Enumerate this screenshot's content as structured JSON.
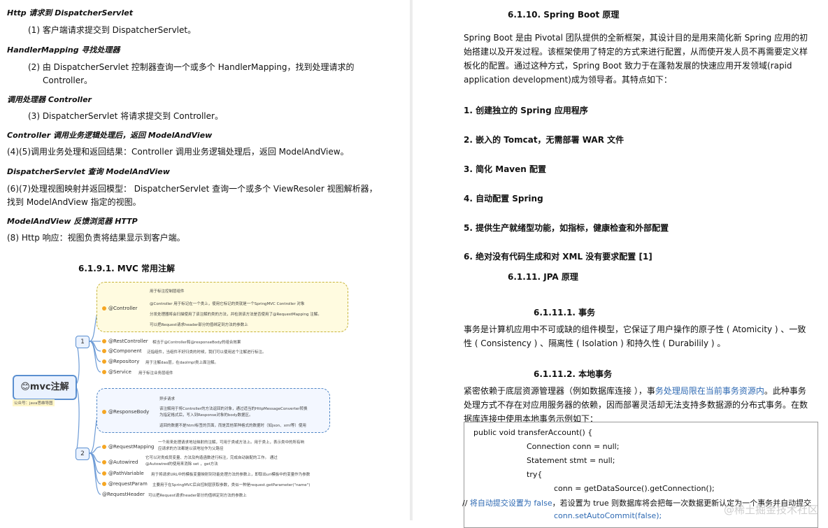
{
  "left": {
    "blocks": [
      {
        "heading": "Http 请求到 DispatcherServlet",
        "lines": [
          "(1) 客户端请求提交到 DispatcherServlet。"
        ]
      },
      {
        "heading": "HandlerMapping 寻找处理器",
        "lines": [
          "(2) 由 DispatcherServlet 控制器查询一个或多个 HandlerMapping，找到处理请求的",
          "Controller。"
        ]
      },
      {
        "heading": "调用处理器 Controller",
        "lines": [
          "(3) DispatcherServlet 将请求提交到 Controller。"
        ]
      },
      {
        "heading": "Controller 调用业务逻辑处理后，返回 ModelAndView",
        "lines": [
          "(4)(5)调用业务处理和返回结果：Controller 调用业务逻辑处理后，返回 ModelAndView。"
        ]
      },
      {
        "heading": "DispatcherServlet 查询 ModelAndView",
        "lines": [
          "(6)(7)处理视图映射并返回模型： DispatcherServlet 查询一个或多个 ViewResoler 视图解析器，",
          "找到 ModelAndView 指定的视图。"
        ]
      },
      {
        "heading": "ModelAndView 反馈浏览器 HTTP",
        "lines": [
          "(8) Http 响应：视图负责将结果显示到客户端。"
        ]
      }
    ],
    "section_title": "6.1.9.1.    MVC 常用注解",
    "mindmap": {
      "root": "😊mvc注解",
      "root_note": "公众号：java思维导图",
      "group1": "1",
      "group2": "2",
      "controller": {
        "label": "@Controller",
        "notes": [
          "用于标注控制层组件",
          "@Controller 用于标记在一个类上，使用它标记的类就是一个SpringMVC Controller 对象",
          "分发处理器将会扫描使用了该注解的类的方法，并检测该方法是否使用了@RequestMapping 注解。",
          "可以把Request请求header部分的值绑定到方法的参数上"
        ]
      },
      "items1": [
        {
          "label": "@RestController",
          "note": "相当于@Controller和@responseBody的组合效果"
        },
        {
          "label": "@Component",
          "note": "泛指组件，当组件不好归类的时候，我们可以使用这个注解进行标注。"
        },
        {
          "label": "@Repository",
          "note": "用于注解dao层，在daoImpl类上面注解。"
        },
        {
          "label": "@Service",
          "note": "用于标注业务层组件"
        }
      ],
      "responsebody": {
        "label": "@ResponseBody",
        "notes": [
          "异步请求",
          "该注解用于将Controller的方法返回的对象，通过适当的HttpMessageConverter转换",
          "为指定格式后，写入到Response对象的body数据区。",
          "返回的数据不是html标签的页面，而是其他某种格式的数据时（如json、xml等）使用"
        ]
      },
      "items2": [
        {
          "label": "@RequestMapping",
          "note": "一个用来处理请求地址映射的注解，可用于类或方法上。用于类上，表示类中的所有响",
          "note2": "应请求的方法都是以该地址作为父路径"
        },
        {
          "label": "@Autowired",
          "note": "它可以对类成员变量、方法及构造函数进行标注，完成自动装配的工作。 通过",
          "note2": "@Autowired的使用来消除 set ，get方法"
        },
        {
          "label": "@PathVariable",
          "note": "用于将请求URL中的模板变量映射到功能处理方法的参数上，即取出uri模板中的变量作为参数",
          "note2": ""
        },
        {
          "label": "@requestParam",
          "note": "主要用于在SpringMVC后台控制层获取参数，类似一种是request.getParameter(\"name\")",
          "note2": ""
        },
        {
          "label": "@RequestHeader",
          "note": "可以把Request请求header部分的值绑定到方法的参数上",
          "note2": ""
        }
      ]
    }
  },
  "right": {
    "title": "6.1.10.    Spring Boot 原理",
    "intro": "Spring Boot 是由 Pivotal 团队提供的全新框架，其设计目的是用来简化新 Spring 应用的初始搭建以及开发过程。该框架使用了特定的方式来进行配置，从而使开发人员不再需要定义样板化的配置。通过这种方式，Spring Boot 致力于在蓬勃发展的快速应用开发领域(rapid application development)成为领导者。其特点如下：",
    "features": [
      "1. 创建独立的 Spring 应用程序",
      "2. 嵌入的 Tomcat，无需部署 WAR 文件",
      "3. 简化 Maven 配置",
      "4. 自动配置 Spring",
      "5. 提供生产就绪型功能，如指标，健康检查和外部配置",
      "6. 绝对没有代码生成和对 XML 没有要求配置 [1]"
    ],
    "jpa_title": "6.1.11.    JPA 原理",
    "tx_title": "6.1.11.1.    事务",
    "tx_text": "事务是计算机应用中不可或缺的组件模型，它保证了用户操作的原子性 ( Atomicity ) 、一致性 ( Consistency ) 、隔离性 ( Isolation ) 和持久性 ( Durabilily ) 。",
    "local_title": "6.1.11.2.    本地事务",
    "local_pre": "紧密依赖于底层资源管理器（例如数据库连接 ），事",
    "local_blue": "务处理局限在当前事务资源内",
    "local_post": "。此种事务处理方式不存在对应用服务器的依赖，因而部署灵活却无法支持多数据源的分布式事务。在数据库连接中使用本地事务示例如下：",
    "code": [
      "public void transferAccount() {",
      "Connection conn = null;",
      "Statement stmt = null;",
      "try{",
      "conn = getDataSource().getConnection();",
      "conn.setAutoCommit(false);"
    ],
    "comment_pre": "// ",
    "comment_blue": "将自动提交设置为 false",
    "comment_post": "，若设置为 true 则数据库将会把每一次数据更新认定为一个事务并自动提交",
    "watermark": "@稀土掘金技术社区"
  }
}
